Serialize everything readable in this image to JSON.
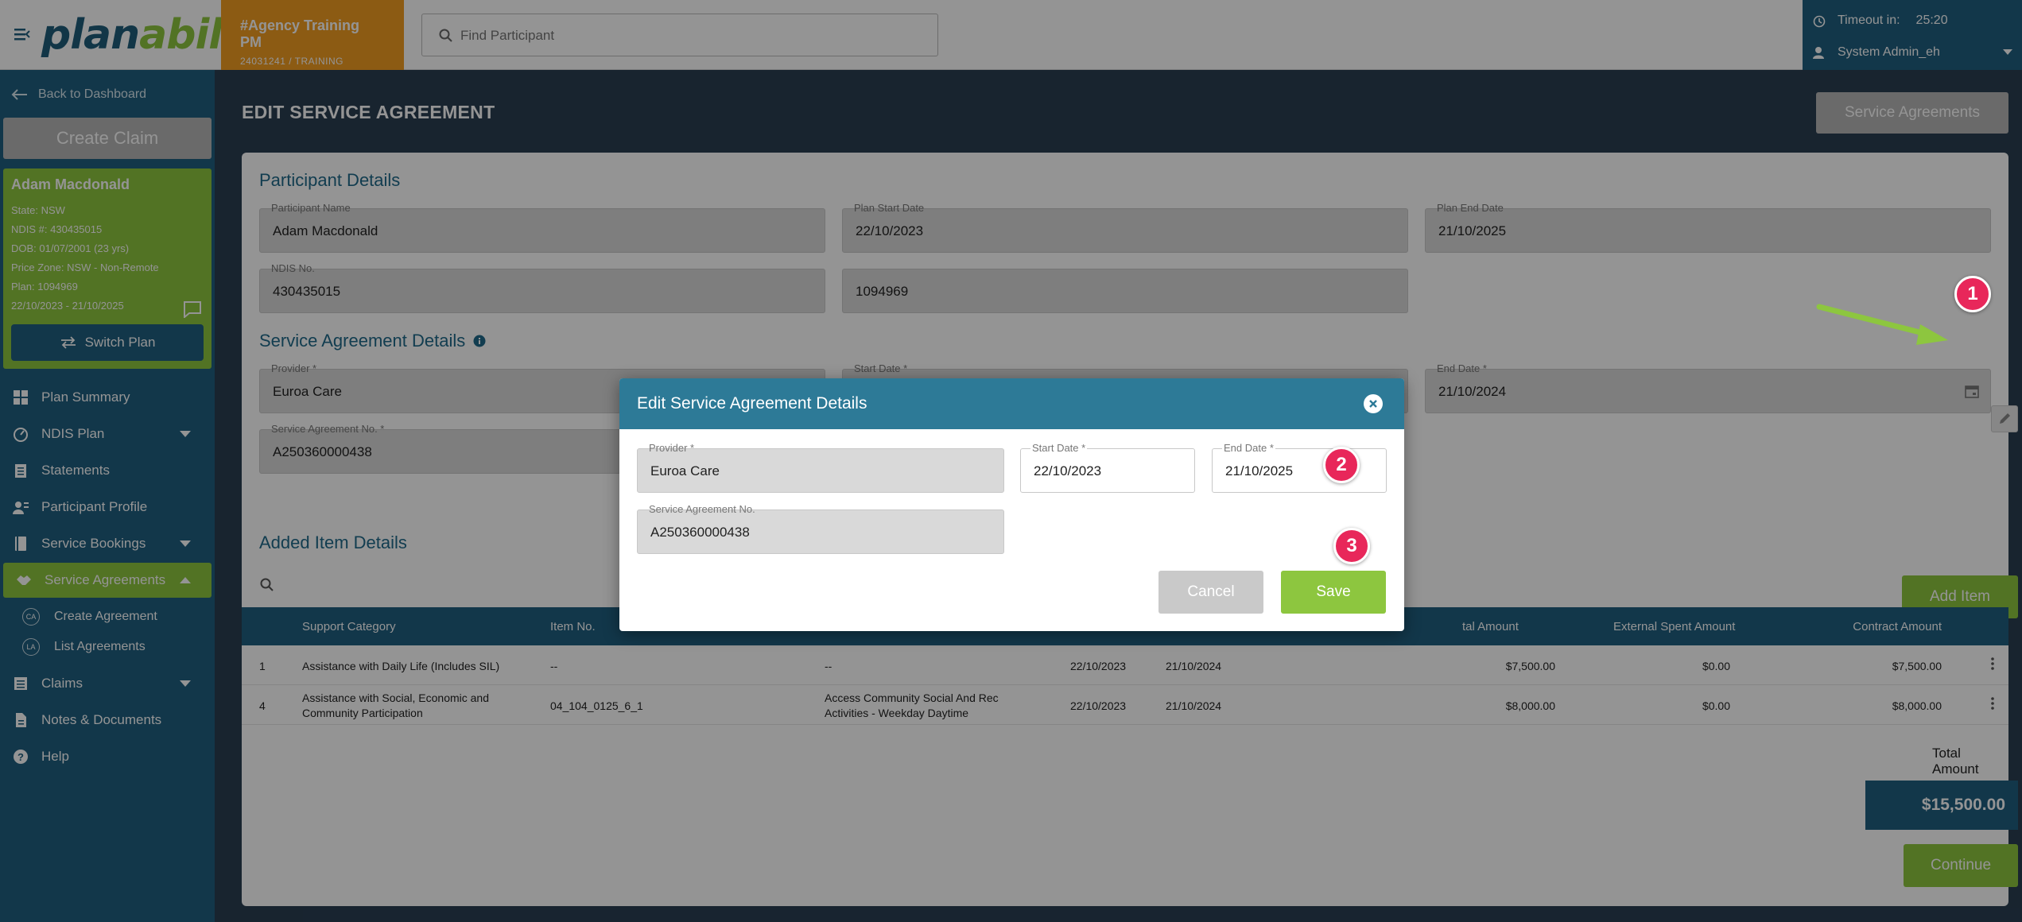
{
  "app": {
    "logo_a": "plan",
    "logo_b": "ability"
  },
  "agency": {
    "name": "#Agency Training PM",
    "code": "24031241 / TRAINING"
  },
  "search": {
    "placeholder": "Find Participant"
  },
  "session": {
    "timeout_label": "Timeout in:",
    "timeout_value": "25:20",
    "user": "System Admin_eh"
  },
  "sidebar": {
    "back": "Back to Dashboard",
    "create_claim": "Create Claim",
    "participant": {
      "name": "Adam Macdonald",
      "state": "State: NSW",
      "ndis": "NDIS #: 430435015",
      "dob": "DOB: 01/07/2001 (23 yrs)",
      "price_zone": "Price Zone: NSW - Non-Remote",
      "plan": "Plan: 1094969",
      "dates": "22/10/2023 - 21/10/2025"
    },
    "switch_plan": "Switch Plan",
    "items": [
      {
        "label": "Plan Summary"
      },
      {
        "label": "NDIS Plan"
      },
      {
        "label": "Statements"
      },
      {
        "label": "Participant Profile"
      },
      {
        "label": "Service Bookings"
      },
      {
        "label": "Service Agreements"
      },
      {
        "label": "Claims"
      },
      {
        "label": "Notes & Documents"
      },
      {
        "label": "Help"
      }
    ],
    "subitems": [
      {
        "badge": "CA",
        "label": "Create Agreement"
      },
      {
        "badge": "LA",
        "label": "List Agreements"
      }
    ]
  },
  "page": {
    "title": "EDIT SERVICE AGREEMENT",
    "service_agreements_btn": "Service Agreements",
    "participant_section": "Participant Details",
    "participant_name_label": "Participant Name",
    "participant_name": "Adam Macdonald",
    "plan_start_label": "Plan Start Date",
    "plan_start": "22/10/2023",
    "plan_end_label": "Plan End Date",
    "plan_end": "21/10/2025",
    "ndis_label": "NDIS No.",
    "ndis": "430435015",
    "plan_no": "1094969",
    "sa_section": "Service Agreement Details",
    "provider_label": "Provider *",
    "provider": "Euroa Care",
    "start_label": "Start Date *",
    "end_label": "End Date *",
    "end_value": "21/10/2024",
    "sa_no_label": "Service Agreement No. *",
    "sa_no": "A250360000438",
    "add_item": "Add Item",
    "added_items_section": "Added Item Details",
    "total_label": "Total Amount",
    "total_value": "$15,500.00",
    "continue": "Continue"
  },
  "table": {
    "headers": [
      "Support Category",
      "Item No.",
      "tal Amount",
      "External Spent Amount",
      "Contract Amount"
    ],
    "rows": [
      {
        "no": "1",
        "category": "Assistance with Daily Life (Includes SIL)",
        "item": "--",
        "desc": "--",
        "start": "22/10/2023",
        "end": "21/10/2024",
        "total": "$7,500.00",
        "external": "$0.00",
        "contract": "$7,500.00"
      },
      {
        "no": "4",
        "category_1": "Assistance with Social, Economic and",
        "category_2": "Community Participation",
        "item": "04_104_0125_6_1",
        "desc_1": "Access Community Social And Rec",
        "desc_2": "Activities - Weekday Daytime",
        "start": "22/10/2023",
        "end": "21/10/2024",
        "total": "$8,000.00",
        "external": "$0.00",
        "contract": "$8,000.00"
      }
    ]
  },
  "modal": {
    "title": "Edit Service Agreement Details",
    "provider_label": "Provider *",
    "provider": "Euroa Care",
    "start_label": "Start Date *",
    "start": "22/10/2023",
    "end_label": "End Date *",
    "end": "21/10/2025",
    "sa_no_label": "Service Agreement No.",
    "sa_no": "A250360000438",
    "cancel": "Cancel",
    "save": "Save"
  },
  "annotations": {
    "step1": "1",
    "step2": "2",
    "step3": "3"
  },
  "colors": {
    "brand_blue": "#1f5f80",
    "brand_green": "#8dc63f",
    "agency_orange": "#f29d22",
    "step_pink": "#e8275a"
  }
}
